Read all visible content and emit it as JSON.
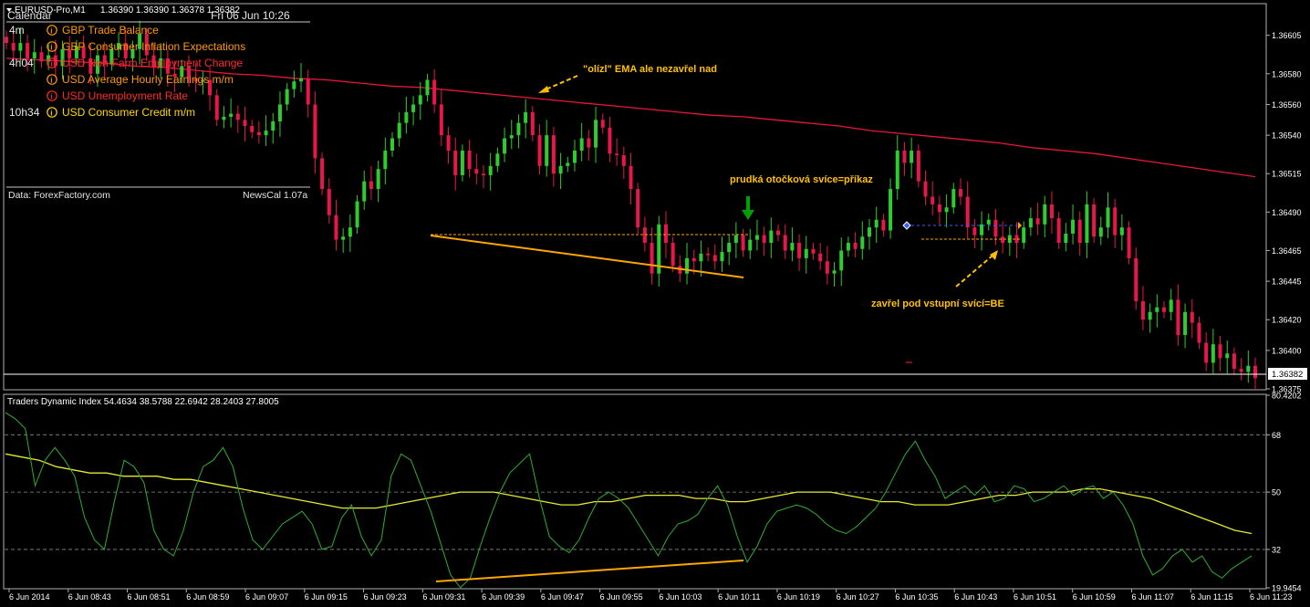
{
  "header": {
    "symbol": "EURUSD-Pro,M1",
    "ohlc": "1.36390 1.36390 1.36378 1.36382"
  },
  "calendar": {
    "title": "Calendar",
    "date": "Fri 06 Jun 10:26",
    "events": [
      {
        "time": "4m",
        "text": "GBP Trade Balance",
        "color": "#ff9900"
      },
      {
        "time": "",
        "text": "GBP Consumer Inflation Expectations",
        "color": "#ff9900"
      },
      {
        "time": "4h04",
        "text": "USD Non-Farm Employment Change",
        "color": "#ff2a2a"
      },
      {
        "time": "",
        "text": "USD Average Hourly Earnings m/m",
        "color": "#ff9900"
      },
      {
        "time": "",
        "text": "USD Unemployment Rate",
        "color": "#ff2a2a"
      },
      {
        "time": "10h34",
        "text": "USD Consumer Credit m/m",
        "color": "#ffd700"
      }
    ],
    "source": "Data: ForexFactory.com",
    "version": "NewsCal 1.07a"
  },
  "annotations": {
    "ema_touch": "\"olízl\" EMA ale nezavřel nad",
    "reversal": "prudká otočková svíce=příkaz",
    "breakeven": "zavřel pod vstupní svící=BE"
  },
  "indicator": {
    "label": "Traders Dynamic Index 54.4634 38.5788 22.6942 28.2403 27.8005"
  },
  "chart_data": {
    "type": "candlestick",
    "price_ylim": [
      1.36375,
      1.36625
    ],
    "price_ticks": [
      "1.36605",
      "1.36580",
      "1.36560",
      "1.36540",
      "1.36515",
      "1.36490",
      "1.36465",
      "1.36445",
      "1.36420",
      "1.36400",
      "1.36375"
    ],
    "current_price": "1.36382",
    "x_tick_labels": [
      "6 Jun 2014",
      "6 Jun 08:43",
      "6 Jun 08:51",
      "6 Jun 08:59",
      "6 Jun 09:07",
      "6 Jun 09:15",
      "6 Jun 09:23",
      "6 Jun 09:31",
      "6 Jun 09:39",
      "6 Jun 09:47",
      "6 Jun 09:55",
      "6 Jun 10:03",
      "6 Jun 10:11",
      "6 Jun 10:19",
      "6 Jun 10:27",
      "6 Jun 10:35",
      "6 Jun 10:43",
      "6 Jun 10:51",
      "6 Jun 10:59",
      "6 Jun 11:07",
      "6 Jun 11:15",
      "6 Jun 11:23"
    ],
    "close": [
      1.366,
      1.36595,
      1.366,
      1.3659,
      1.36594,
      1.36588,
      1.36592,
      1.36585,
      1.36596,
      1.3659,
      1.36598,
      1.3659,
      1.3658,
      1.36592,
      1.36586,
      1.36596,
      1.366,
      1.3659,
      1.36596,
      1.36606,
      1.36592,
      1.36584,
      1.3659,
      1.3658,
      1.36578,
      1.36585,
      1.36577,
      1.36575,
      1.36576,
      1.36566,
      1.3655,
      1.36552,
      1.36554,
      1.3655,
      1.36546,
      1.36542,
      1.3654,
      1.36543,
      1.36549,
      1.3656,
      1.3657,
      1.36575,
      1.36577,
      1.3656,
      1.36525,
      1.36505,
      1.36488,
      1.36472,
      1.36474,
      1.3648,
      1.36497,
      1.3651,
      1.36505,
      1.36518,
      1.3653,
      1.36538,
      1.36548,
      1.36555,
      1.3656,
      1.36566,
      1.36576,
      1.3656,
      1.3654,
      1.3653,
      1.36514,
      1.3653,
      1.36518,
      1.36515,
      1.36514,
      1.3652,
      1.36528,
      1.36538,
      1.3654,
      1.36548,
      1.36555,
      1.3654,
      1.3652,
      1.3654,
      1.36515,
      1.3652,
      1.36522,
      1.3653,
      1.36538,
      1.36532,
      1.3655,
      1.36545,
      1.36528,
      1.36527,
      1.3652,
      1.36505,
      1.3648,
      1.3647,
      1.3645,
      1.36482,
      1.3647,
      1.36455,
      1.3645,
      1.3646,
      1.36458,
      1.36463,
      1.36462,
      1.36458,
      1.36464,
      1.3647,
      1.36475,
      1.36465,
      1.36472,
      1.36475,
      1.3647,
      1.36478,
      1.36475,
      1.36465,
      1.3647,
      1.3646,
      1.36466,
      1.36463,
      1.36458,
      1.3645,
      1.36452,
      1.36465,
      1.3647,
      1.36466,
      1.36474,
      1.3648,
      1.36485,
      1.36478,
      1.36505,
      1.3653,
      1.36522,
      1.3653,
      1.3651,
      1.365,
      1.36495,
      1.3649,
      1.36493,
      1.36505,
      1.365,
      1.3648,
      1.36475,
      1.36482,
      1.36485,
      1.36474,
      1.3647,
      1.36475,
      1.3647,
      1.3648,
      1.36486,
      1.36482,
      1.36495,
      1.36486,
      1.3647,
      1.36476,
      1.36485,
      1.3647,
      1.36495,
      1.36474,
      1.3648,
      1.36493,
      1.36475,
      1.3648,
      1.3646,
      1.36432,
      1.3642,
      1.36425,
      1.36428,
      1.36425,
      1.36433,
      1.3641,
      1.36425,
      1.36418,
      1.36405,
      1.36392,
      1.36404,
      1.36395,
      1.36398,
      1.36388,
      1.36386,
      1.3639,
      1.36382
    ],
    "ema": [
      1.3659,
      1.36589,
      1.36588,
      1.36587,
      1.36585,
      1.36584,
      1.36582,
      1.3658,
      1.36579,
      1.36577,
      1.36576,
      1.36574,
      1.36572,
      1.36571,
      1.36569,
      1.36567,
      1.36565,
      1.36563,
      1.36561,
      1.36559,
      1.36557,
      1.36555,
      1.36553,
      1.36552,
      1.3655,
      1.36548,
      1.36546,
      1.36543,
      1.36541,
      1.36539,
      1.36537,
      1.36535,
      1.36532,
      1.3653,
      1.36528,
      1.36525,
      1.36522,
      1.36519,
      1.36516,
      1.36513
    ],
    "tdi_ylim": [
      19.9454,
      80.4202
    ],
    "tdi_ticks": [
      "80.4202",
      "68",
      "50",
      "32",
      "19.9454"
    ],
    "tdi_rsi": [
      75,
      73,
      70,
      52,
      60,
      64,
      60,
      55,
      42,
      35,
      32,
      47,
      60,
      58,
      53,
      38,
      32,
      30,
      38,
      50,
      58,
      60,
      64,
      58,
      45,
      35,
      32,
      36,
      40,
      42,
      44,
      40,
      32,
      33,
      42,
      46,
      36,
      30,
      35,
      55,
      62,
      60,
      52,
      44,
      34,
      24,
      20,
      23,
      33,
      42,
      50,
      56,
      59,
      62,
      48,
      36,
      33,
      31,
      35,
      42,
      48,
      50,
      48,
      45,
      40,
      35,
      30,
      36,
      40,
      41,
      43,
      48,
      52,
      46,
      36,
      28,
      33,
      40,
      44,
      45,
      46,
      45,
      43,
      40,
      38,
      37,
      39,
      42,
      45,
      50,
      56,
      62,
      66,
      60,
      55,
      48,
      50,
      52,
      49,
      52,
      47,
      48,
      52,
      51,
      47,
      48,
      50,
      52,
      49,
      51,
      52,
      48,
      50,
      46,
      40,
      30,
      24,
      26,
      30,
      32,
      28,
      30,
      25,
      23,
      26,
      28,
      30
    ],
    "tdi_signal": [
      62,
      61,
      60,
      58,
      57,
      56,
      56,
      55,
      55,
      55,
      54,
      54,
      53,
      52,
      51,
      50,
      49,
      48,
      47,
      46,
      45,
      45,
      45,
      46,
      47,
      48,
      49,
      50,
      50,
      50,
      49,
      48,
      47,
      46,
      46,
      47,
      47,
      48,
      49,
      49,
      49,
      48,
      48,
      47,
      47,
      48,
      49,
      50,
      50,
      50,
      49,
      48,
      47,
      47,
      46,
      46,
      46,
      47,
      48,
      49,
      49,
      50,
      50,
      50,
      51,
      51,
      50,
      49,
      48,
      46,
      44,
      42,
      40,
      38,
      37
    ],
    "tdi_levels": [
      68,
      50,
      32
    ]
  }
}
